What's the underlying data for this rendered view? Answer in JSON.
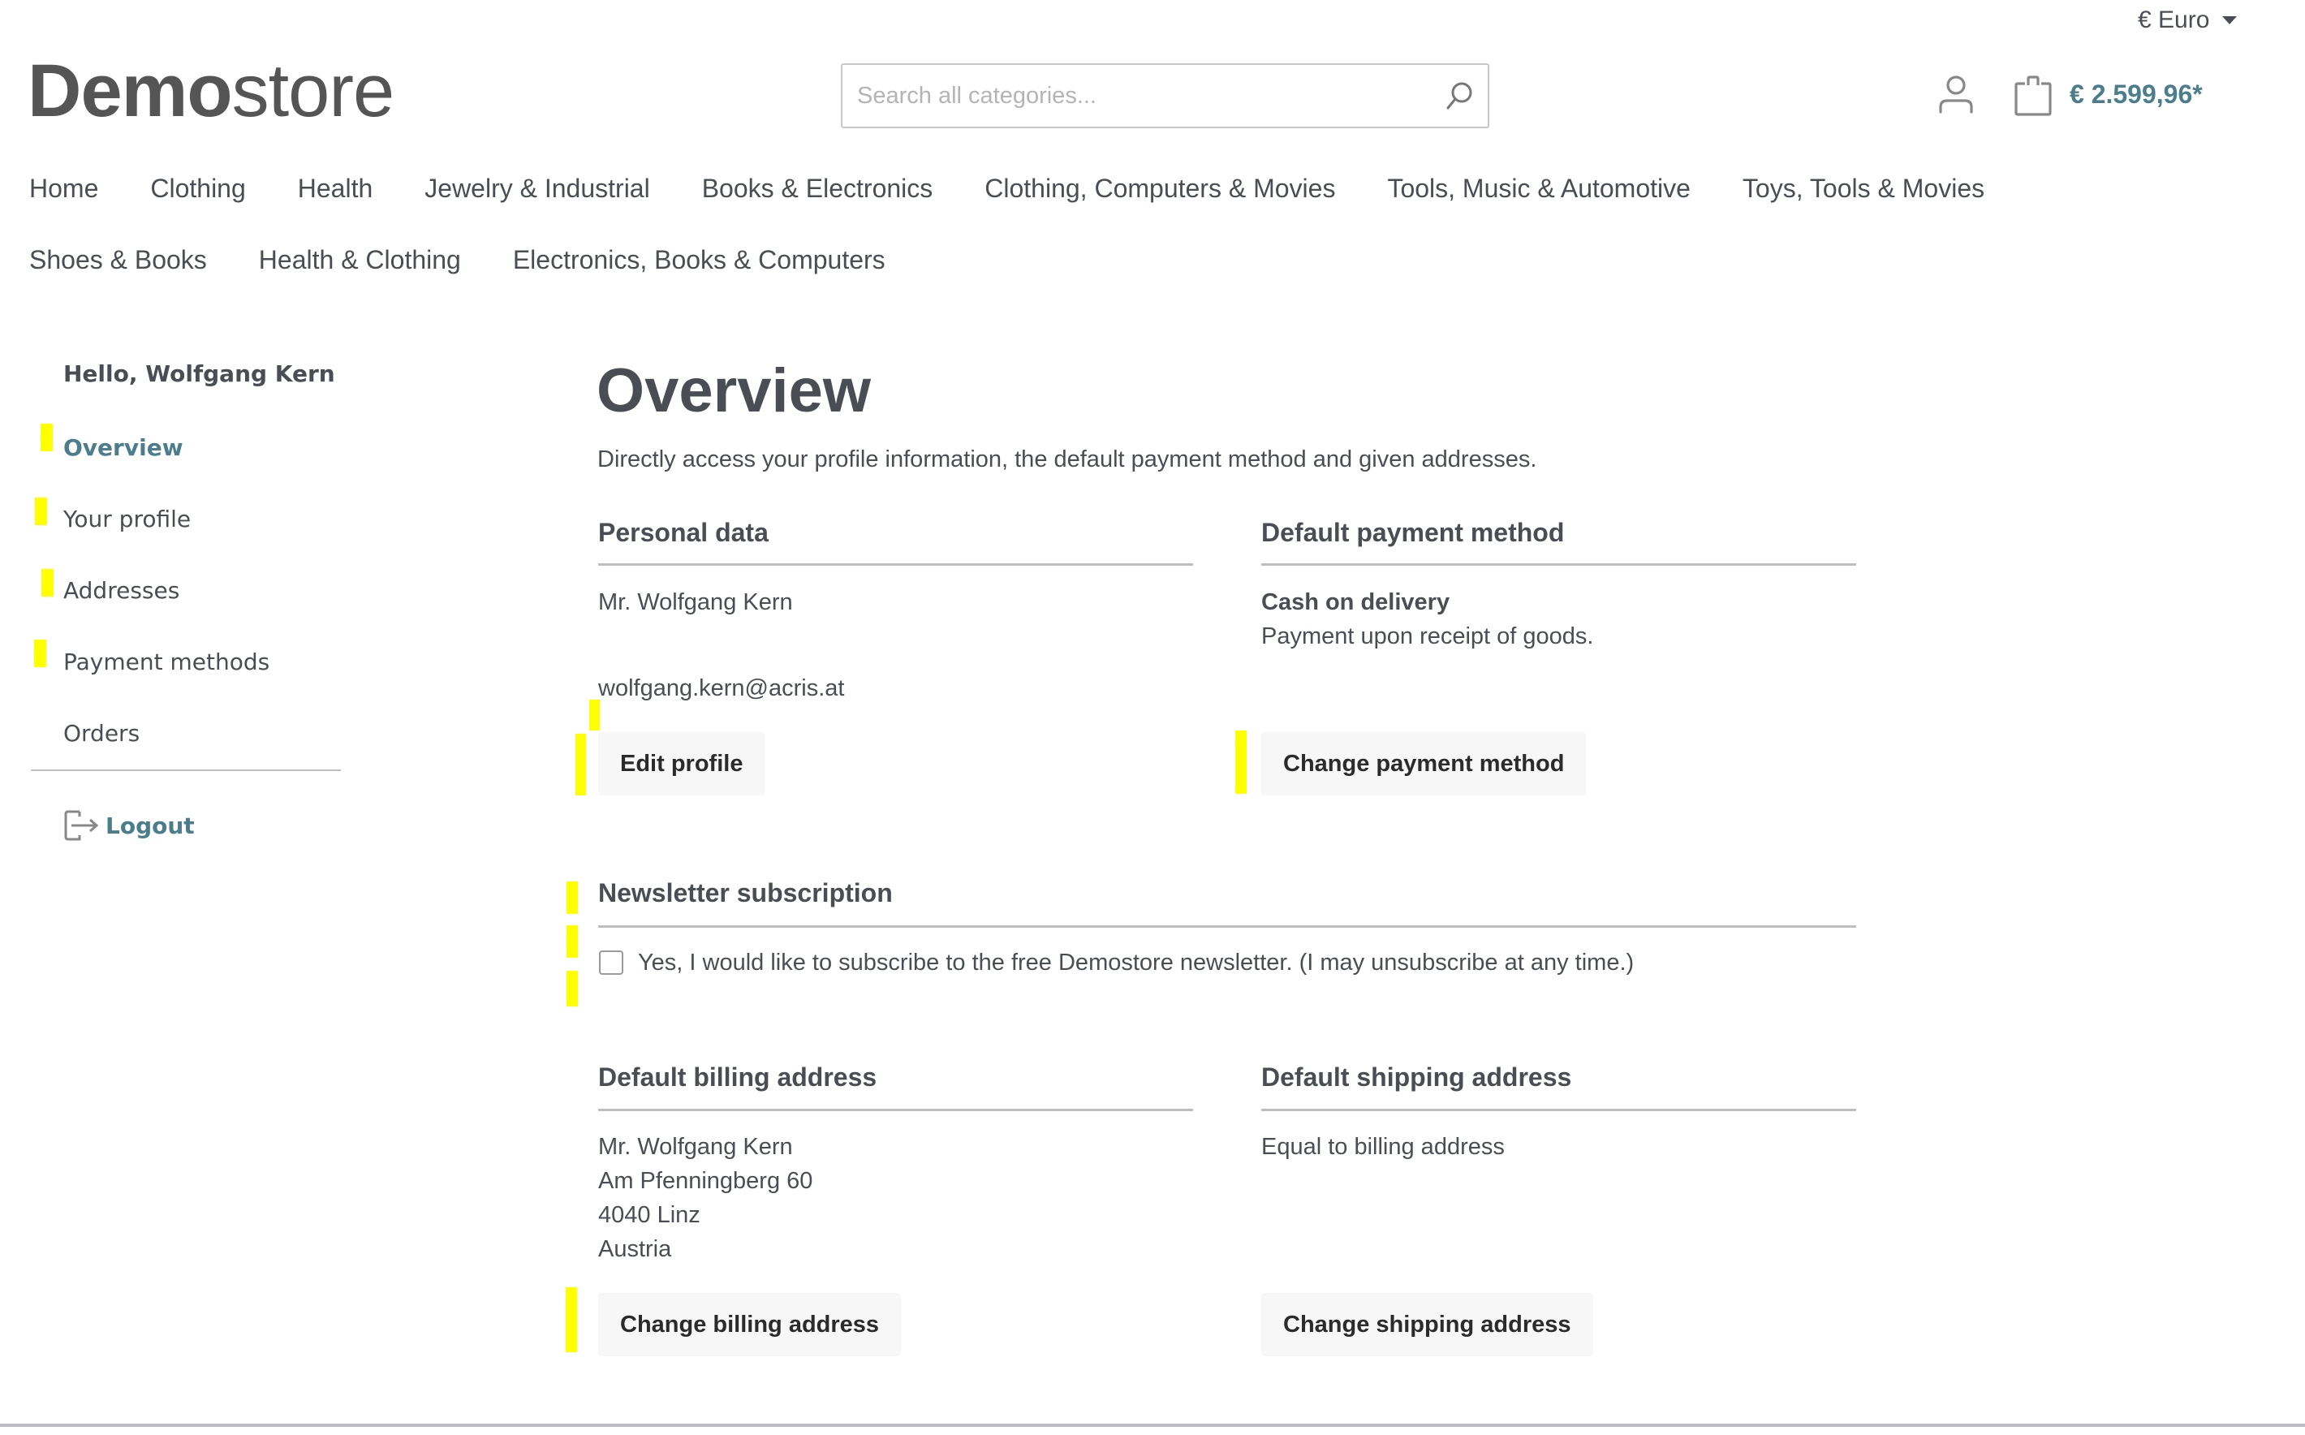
{
  "header": {
    "currency": "€ Euro",
    "logo_bold": "Demo",
    "logo_light": "store",
    "search_placeholder": "Search all categories...",
    "search_value": "",
    "cart_total": "€ 2.599,96*",
    "icons": {
      "search": "search-icon",
      "account": "user-icon",
      "cart": "shopping-bag-icon",
      "currency": "caret-down-icon"
    }
  },
  "nav": {
    "row1": [
      "Home",
      "Clothing",
      "Health",
      "Jewelry & Industrial",
      "Books & Electronics",
      "Clothing, Computers & Movies",
      "Tools, Music & Automotive",
      "Toys, Tools & Movies"
    ],
    "row2": [
      "Shoes & Books",
      "Health & Clothing",
      "Electronics, Books & Computers"
    ]
  },
  "sidebar": {
    "greeting": "Hello, Wolfgang Kern",
    "items": [
      {
        "label": "Overview",
        "active": true
      },
      {
        "label": "Your profile",
        "active": false
      },
      {
        "label": "Addresses",
        "active": false
      },
      {
        "label": "Payment methods",
        "active": false
      },
      {
        "label": "Orders",
        "active": false
      }
    ],
    "logout": "Logout"
  },
  "main": {
    "title": "Overview",
    "description": "Directly access your profile information, the default payment method and given addresses.",
    "personal": {
      "heading": "Personal data",
      "name": "Mr. Wolfgang Kern",
      "email": "wolfgang.kern@acris.at",
      "button": "Edit profile"
    },
    "payment": {
      "heading": "Default payment method",
      "method": "Cash on delivery",
      "method_desc": "Payment upon receipt of goods.",
      "button": "Change payment method"
    },
    "newsletter": {
      "heading": "Newsletter subscription",
      "checkbox_label": "Yes, I would like to subscribe to the free Demostore newsletter. (I may unsubscribe at any time.)",
      "checked": false
    },
    "billing": {
      "heading": "Default billing address",
      "lines": [
        "Mr. Wolfgang Kern",
        "Am Pfenningberg 60",
        "4040 Linz",
        "Austria"
      ],
      "button": "Change billing address"
    },
    "shipping": {
      "heading": "Default shipping address",
      "text": "Equal to billing address",
      "button": "Change shipping address"
    }
  },
  "colors": {
    "accent": "#4b7d8c",
    "text": "#4a4e54",
    "button_bg": "#f7f7f7",
    "rule": "#bdbdc2",
    "highlight": "#ffff00"
  }
}
